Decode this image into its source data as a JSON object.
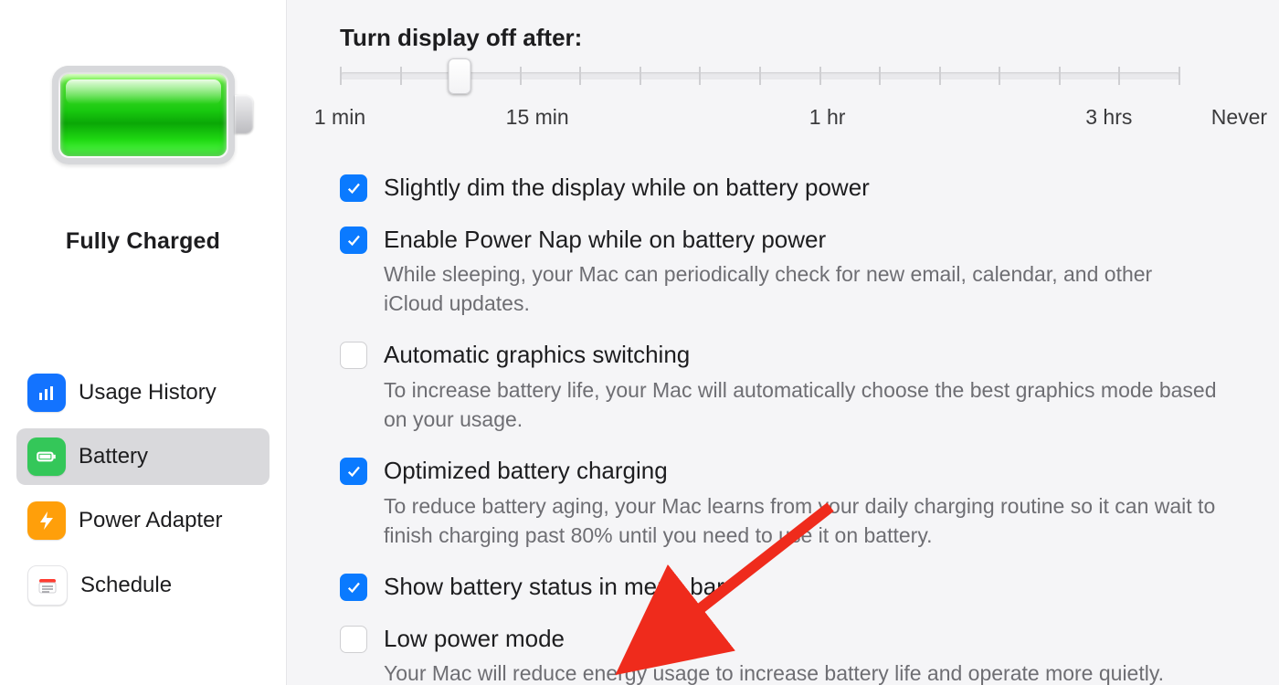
{
  "sidebar": {
    "status_label": "Fully Charged",
    "items": [
      {
        "label": "Usage History",
        "selected": false
      },
      {
        "label": "Battery",
        "selected": true
      },
      {
        "label": "Power Adapter",
        "selected": false
      },
      {
        "label": "Schedule",
        "selected": false
      }
    ]
  },
  "main": {
    "slider_title": "Turn display off after:",
    "slider_ticks": 15,
    "slider_thumb_index": 2,
    "slider_labels": [
      {
        "text": "1 min",
        "pos": 0.0
      },
      {
        "text": "15 min",
        "pos": 0.235
      },
      {
        "text": "1 hr",
        "pos": 0.58
      },
      {
        "text": "3 hrs",
        "pos": 0.915
      },
      {
        "text": "Never",
        "pos": 1.07
      }
    ],
    "options": [
      {
        "checked": true,
        "label": "Slightly dim the display while on battery power",
        "desc": ""
      },
      {
        "checked": true,
        "label": "Enable Power Nap while on battery power",
        "desc": "While sleeping, your Mac can periodically check for new email, calendar, and other iCloud updates."
      },
      {
        "checked": false,
        "label": "Automatic graphics switching",
        "desc": "To increase battery life, your Mac will automatically choose the best graphics mode based on your usage."
      },
      {
        "checked": true,
        "label": "Optimized battery charging",
        "desc": "To reduce battery aging, your Mac learns from your daily charging routine so it can wait to finish charging past 80% until you need to use it on battery."
      },
      {
        "checked": true,
        "label": "Show battery status in menu bar",
        "desc": ""
      },
      {
        "checked": false,
        "label": "Low power mode",
        "desc": "Your Mac will reduce energy usage to increase battery life and operate more quietly."
      }
    ]
  }
}
